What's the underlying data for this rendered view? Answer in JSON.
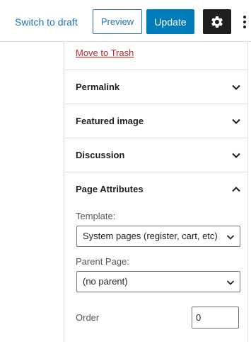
{
  "toolbar": {
    "switch_to_draft": "Switch to draft",
    "preview": "Preview",
    "update": "Update",
    "settings_icon": "gear-icon",
    "more_icon": "kebab-menu-icon"
  },
  "sidebar": {
    "move_to_trash": "Move to Trash",
    "sections": [
      {
        "title": "Permalink",
        "expanded": false
      },
      {
        "title": "Featured image",
        "expanded": false
      },
      {
        "title": "Discussion",
        "expanded": false
      },
      {
        "title": "Page Attributes",
        "expanded": true
      }
    ],
    "page_attributes": {
      "template_label": "Template:",
      "template_value": "System pages (register, cart, etc)",
      "parent_label": "Parent Page:",
      "parent_value": "(no parent)",
      "order_label": "Order",
      "order_value": "0"
    }
  },
  "colors": {
    "accent": "#007cba",
    "link": "#2271b1",
    "danger": "#b32d2e",
    "settings_bg": "#1e1e1e"
  }
}
